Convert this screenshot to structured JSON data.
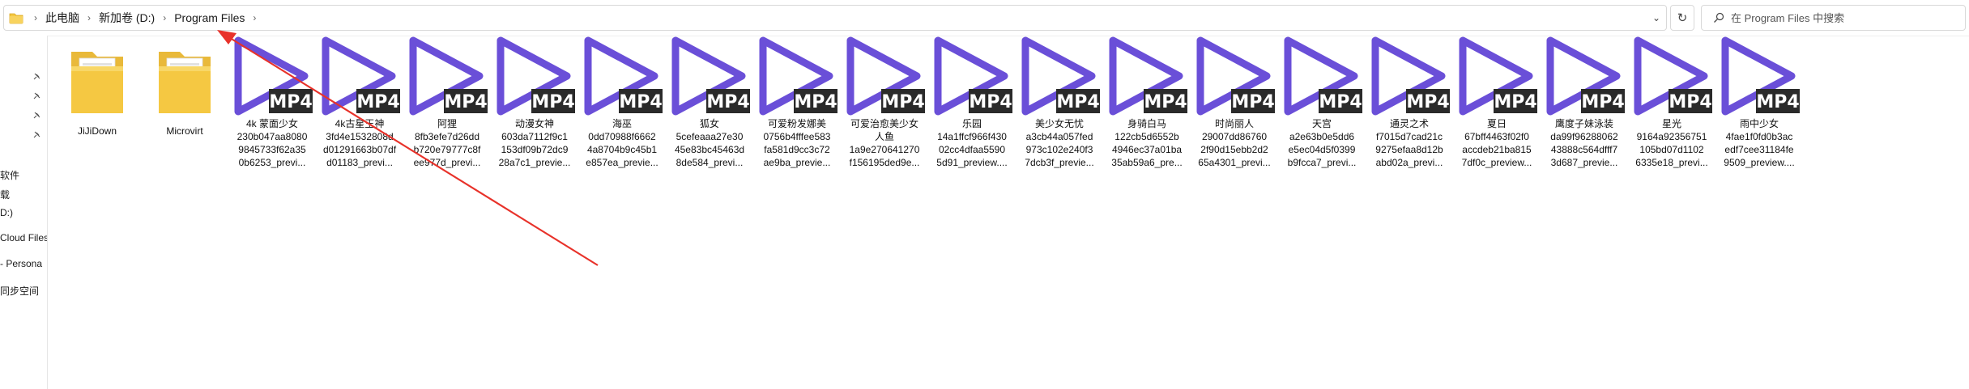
{
  "address": {
    "crumbs": [
      "此电脑",
      "新加卷 (D:)",
      "Program Files"
    ],
    "dropdown_glyph": "⌄",
    "refresh_glyph": "↻"
  },
  "search": {
    "placeholder": "在 Program Files 中搜索"
  },
  "nav": {
    "items": [
      "软件",
      "载",
      "D:)",
      "Cloud Files",
      "- Persona",
      "同步空间"
    ]
  },
  "folders": [
    {
      "name": "JiJiDown"
    },
    {
      "name": "Microvirt"
    }
  ],
  "video_badge": "MP4",
  "videos": [
    {
      "line1": "4k 蒙面少女",
      "line2": "230b047aa8080",
      "line3": "9845733f62a35",
      "line4": "0b6253_previ..."
    },
    {
      "line1": "4k古星玉神",
      "line2": "3fd4e1532808d",
      "line3": "d01291663b07df",
      "line4": "d01183_previ..."
    },
    {
      "line1": "阿狸",
      "line2": "8fb3efe7d26dd",
      "line3": "b720e79777c8f",
      "line4": "ee977d_previ..."
    },
    {
      "line1": "动漫女神",
      "line2": "603da7112f9c1",
      "line3": "153df09b72dc9",
      "line4": "28a7c1_previe..."
    },
    {
      "line1": "海巫",
      "line2": "0dd70988f6662",
      "line3": "4a8704b9c45b1",
      "line4": "e857ea_previe..."
    },
    {
      "line1": "狐女",
      "line2": "5cefeaaa27e30",
      "line3": "45e83bc45463d",
      "line4": "8de584_previ..."
    },
    {
      "line1": "可爱粉发娜美",
      "line2": "0756b4fffee583",
      "line3": "fa581d9cc3c72",
      "line4": "ae9ba_previe..."
    },
    {
      "line1": "可爱治愈美少女",
      "line2": "人鱼",
      "line3": "1a9e270641270",
      "line4": "f156195ded9e..."
    },
    {
      "line1": "乐园",
      "line2": "14a1ffcf966f430",
      "line3": "02cc4dfaa5590",
      "line4": "5d91_preview...."
    },
    {
      "line1": "美少女无忧",
      "line2": "a3cb44a057fed",
      "line3": "973c102e240f3",
      "line4": "7dcb3f_previe..."
    },
    {
      "line1": "身骑白马",
      "line2": "122cb5d6552b",
      "line3": "4946ec37a01ba",
      "line4": "35ab59a6_pre..."
    },
    {
      "line1": "时尚丽人",
      "line2": "29007dd86760",
      "line3": "2f90d15ebb2d2",
      "line4": "65a4301_previ..."
    },
    {
      "line1": "天宫",
      "line2": "a2e63b0e5dd6",
      "line3": "e5ec04d5f0399",
      "line4": "b9fcca7_previ..."
    },
    {
      "line1": "通灵之术",
      "line2": "f7015d7cad21c",
      "line3": "9275efaa8d12b",
      "line4": "abd02a_previ..."
    },
    {
      "line1": "夏日",
      "line2": "67bff4463f02f0",
      "line3": "accdeb21ba815",
      "line4": "7df0c_preview..."
    },
    {
      "line1": "鹰度子妹泳装",
      "line2": "da99f96288062",
      "line3": "43888c564dfff7",
      "line4": "3d687_previe..."
    },
    {
      "line1": "星光",
      "line2": "9164a92356751",
      "line3": "105bd07d1102",
      "line4": "6335e18_previ..."
    },
    {
      "line1": "雨中少女",
      "line2": "4fae1f0fd0b3ac",
      "line3": "edf7cee31184fe",
      "line4": "9509_preview...."
    }
  ],
  "colors": {
    "play_triangle": "#6a4fd8",
    "badge_bg": "#2a2a2a",
    "badge_text": "#ffffff",
    "annotation_arrow": "#e8322a",
    "folder_yellow": "#f5c842"
  }
}
